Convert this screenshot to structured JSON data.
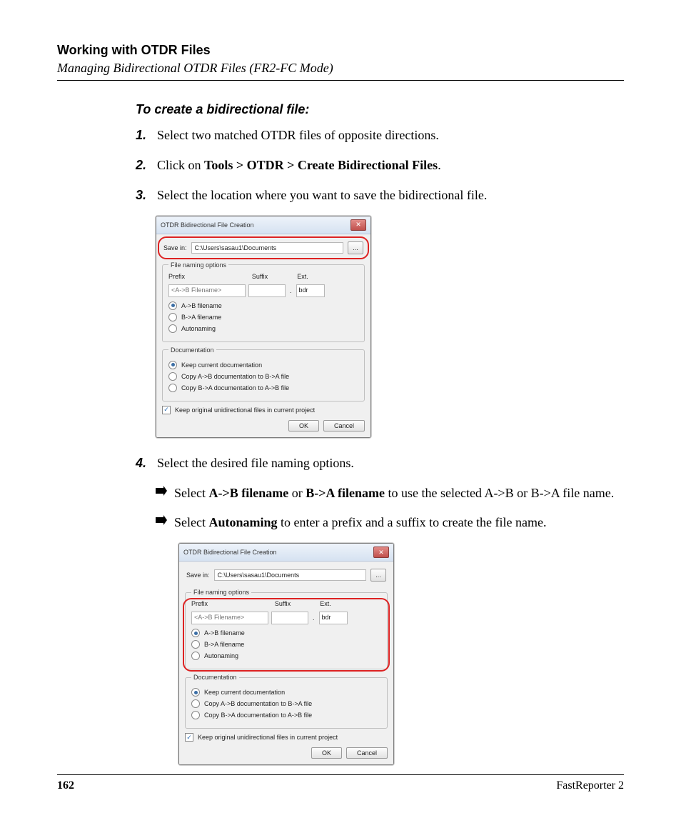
{
  "header": {
    "title": "Working with OTDR Files",
    "subtitle": "Managing Bidirectional OTDR Files (FR2-FC Mode)"
  },
  "lead": "To create a bidirectional file:",
  "steps": {
    "s1": {
      "n": "1.",
      "t": "Select two matched OTDR files of opposite directions."
    },
    "s2": {
      "n": "2.",
      "pre": "Click on ",
      "bold": "Tools > OTDR > Create Bidirectional Files",
      "post": "."
    },
    "s3": {
      "n": "3.",
      "t": "Select the location where you want to save the bidirectional file."
    },
    "s4": {
      "n": "4.",
      "t": "Select the desired file naming options."
    }
  },
  "subs": {
    "a": {
      "p1": "Select ",
      "b1": "A->B filename",
      "p2": " or ",
      "b2": "B->A filename",
      "p3": " to use the selected A->B or B->A file name."
    },
    "b": {
      "p1": "Select ",
      "b1": "Autonaming",
      "p2": " to enter a prefix and a suffix to create the file name."
    }
  },
  "dialog": {
    "title": "OTDR Bidirectional File Creation",
    "savein_label": "Save in:",
    "savein_path": "C:\\Users\\sasau1\\Documents",
    "browse": "...",
    "group_naming": "File naming options",
    "col_prefix": "Prefix",
    "col_suffix": "Suffix",
    "col_ext": "Ext.",
    "prefix_value": "<A->B Filename>",
    "ext_value": "bdr",
    "opt_ab": "A->B filename",
    "opt_ba": "B->A filename",
    "opt_auto": "Autonaming",
    "group_doc": "Documentation",
    "doc_keep": "Keep current documentation",
    "doc_copy_ab": "Copy A->B documentation to B->A file",
    "doc_copy_ba": "Copy B->A documentation to A->B file",
    "keep_orig": "Keep original unidirectional files in current project",
    "btn_ok": "OK",
    "btn_cancel": "Cancel"
  },
  "footer": {
    "page": "162",
    "product": "FastReporter 2"
  }
}
